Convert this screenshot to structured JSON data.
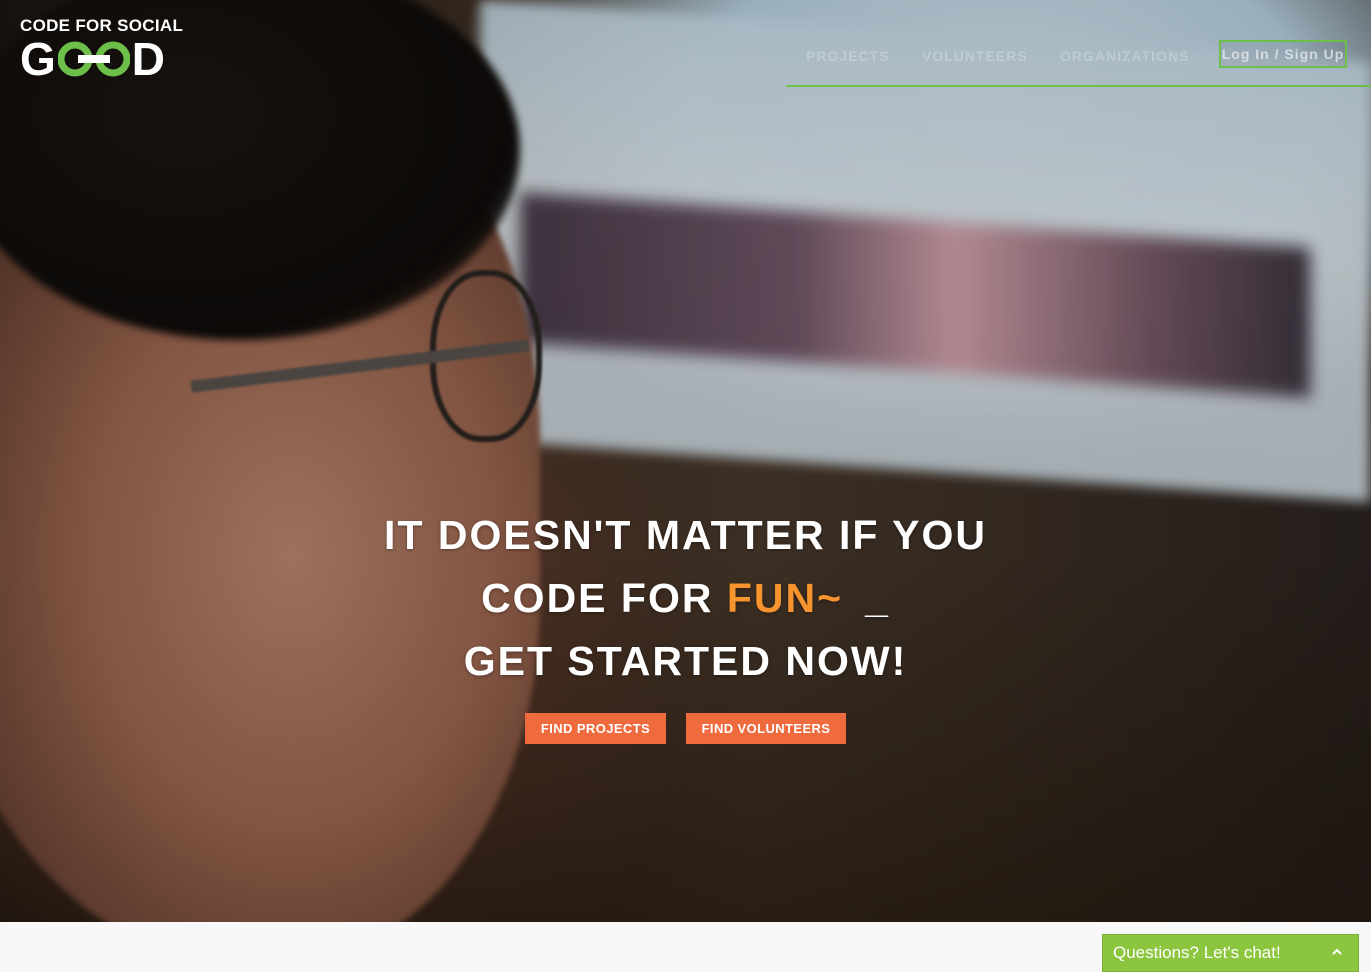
{
  "brand": {
    "line1": "CODE FOR SOCIAL",
    "g": "G",
    "d": "D",
    "accent_color": "#6cc04a"
  },
  "nav": {
    "items": [
      {
        "label": "PROJECTS"
      },
      {
        "label": "VOLUNTEERS"
      },
      {
        "label": "ORGANIZATIONS"
      }
    ],
    "login_label": "Log In / Sign Up"
  },
  "hero": {
    "line1": "IT DOESN'T MATTER IF YOU",
    "line2_prefix": "CODE FOR ",
    "line2_accent": "FUN~",
    "line2_cursor": "_",
    "line3": "GET STARTED NOW!",
    "accent_color": "#f7942d"
  },
  "cta": {
    "find_projects": "FIND PROJECTS",
    "find_volunteers": "FIND VOLUNTEERS",
    "button_color": "#ef6a3d"
  },
  "chat": {
    "label": "Questions? Let's chat!",
    "icon": "chevron-up-icon",
    "color": "#8cc63f"
  }
}
